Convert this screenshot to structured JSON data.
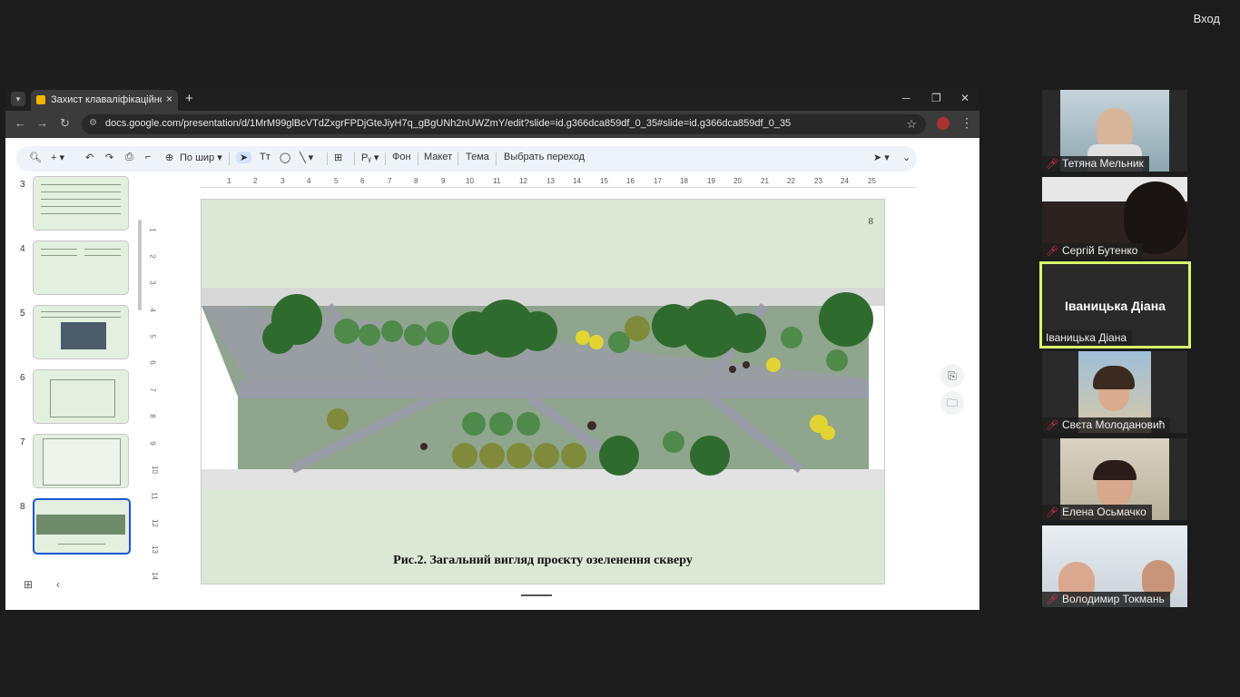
{
  "top": {
    "login": "Вход"
  },
  "browser": {
    "tab_title": "Захист клаваліфікаційної робо",
    "url": "docs.google.com/presentation/d/1MrM99glBcVTdZxgrFPDjGteJiyH7q_gBgUNh2nUWZmY/edit?slide=id.g366dca859df_0_35#slide=id.g366dca859df_0_35"
  },
  "toolbar": {
    "zoom": "По шир",
    "background": "Фон",
    "layout": "Макет",
    "theme": "Тема",
    "transition": "Выбрать переход"
  },
  "thumbnails": [
    {
      "num": "3"
    },
    {
      "num": "4"
    },
    {
      "num": "5"
    },
    {
      "num": "6"
    },
    {
      "num": "7"
    },
    {
      "num": "8"
    }
  ],
  "ruler": {
    "h": [
      "1",
      "2",
      "3",
      "4",
      "5",
      "6",
      "7",
      "8",
      "9",
      "10",
      "11",
      "12",
      "13",
      "14",
      "15",
      "16",
      "17",
      "18",
      "19",
      "20",
      "21",
      "22",
      "23",
      "24",
      "25"
    ],
    "v": [
      "1",
      "2",
      "3",
      "4",
      "5",
      "6",
      "7",
      "8",
      "9",
      "10",
      "11",
      "12",
      "13",
      "14"
    ]
  },
  "slide": {
    "number": "8",
    "caption": "Рис.2. Загальний вигляд проєкту озеленення скверу"
  },
  "participants": [
    {
      "name": "Тетяна Мельник"
    },
    {
      "name": "Сергій Бутенко"
    },
    {
      "name": "Іваницька Діана"
    },
    {
      "name": "Свєта Молодановић"
    },
    {
      "name": "Елена Осьмачко"
    },
    {
      "name": "Володимир Токмань"
    }
  ],
  "colors": {
    "speaker_border": "#d9f76d",
    "active_thumb": "#1a56d6",
    "slide_bg": "#dbe8d6"
  }
}
